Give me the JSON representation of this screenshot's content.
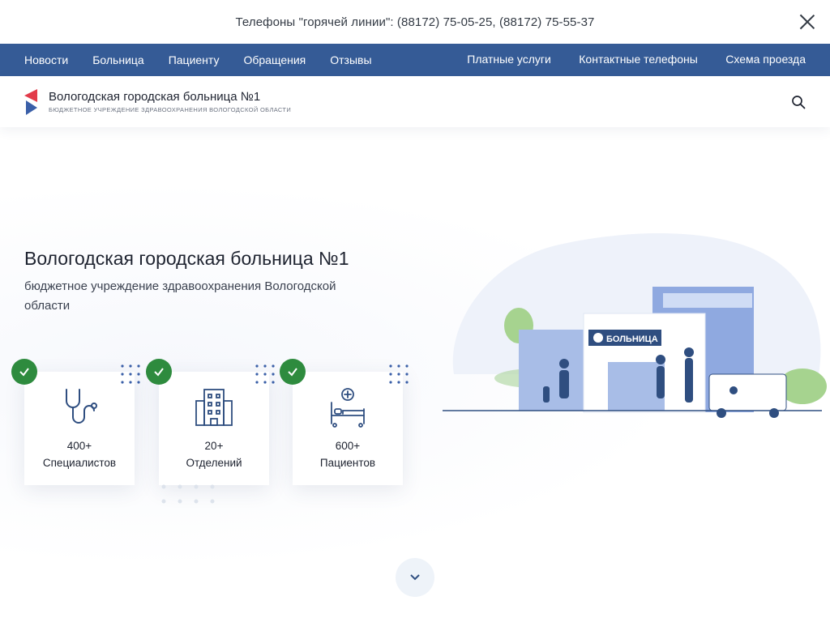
{
  "topbar": {
    "hotline": "Телефоны \"горячей линии\": (88172) 75-05-25, (88172) 75-55-37",
    "close_icon": "close-icon"
  },
  "nav": {
    "left": [
      "Новости",
      "Больница",
      "Пациенту",
      "Обращения",
      "Отзывы"
    ],
    "right": [
      "Платные услуги",
      "Контактные телефоны",
      "Схема проезда"
    ]
  },
  "header": {
    "name": "Вологодская городская больница №1",
    "subtitle": "бюджетное учреждение здравоохранения вологодской области",
    "search_icon": "search-icon"
  },
  "hero": {
    "title": "Вологодская городская больница №1",
    "lead": "бюджетное учреждение здравоохранения Вологодской области",
    "illustration_sign": "БОЛЬНИЦА"
  },
  "stats": [
    {
      "value": "400+",
      "label": "Специалистов",
      "icon": "stethoscope-icon"
    },
    {
      "value": "20+",
      "label": "Отделений",
      "icon": "building-icon"
    },
    {
      "value": "600+",
      "label": "Пациентов",
      "icon": "hospital-bed-icon"
    }
  ],
  "colors": {
    "nav_bg": "#355b96",
    "accent_red": "#e23b4a",
    "accent_blue": "#3a5fa8",
    "check_green": "#2e8b3e",
    "icon_blue": "#2f4e80"
  }
}
